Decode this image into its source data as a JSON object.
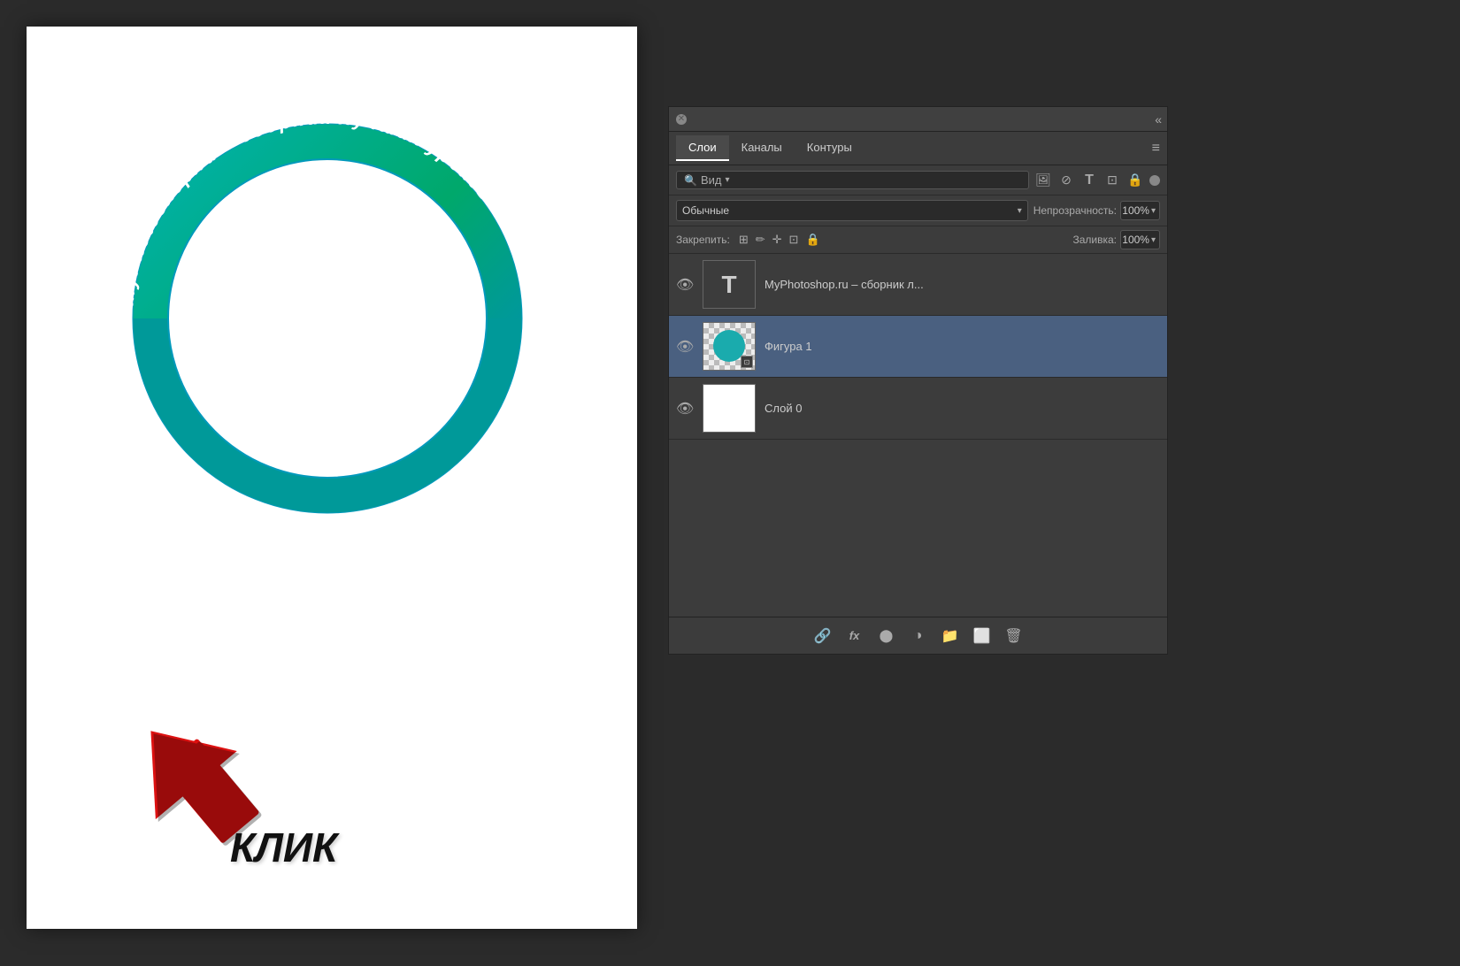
{
  "background_color": "#2b2b2b",
  "canvas": {
    "background": "white"
  },
  "circle_text": "MyPhotoshop.ru – сборник лучших уроков",
  "arrow_label": "КЛИК",
  "panel": {
    "title": "",
    "close_icon": "✕",
    "collapse_icon": "«",
    "tabs": [
      {
        "label": "Слои",
        "active": true
      },
      {
        "label": "Каналы",
        "active": false
      },
      {
        "label": "Контуры",
        "active": false
      }
    ],
    "menu_icon": "≡",
    "search_placeholder": "Вид",
    "filter_icons": [
      "image",
      "circle",
      "T",
      "rect",
      "lock"
    ],
    "blend_mode": "Обычные",
    "blend_dropdown": "▾",
    "opacity_label": "Непрозрачность:",
    "opacity_value": "100%",
    "lock_label": "Закрепить:",
    "lock_icons": [
      "⊞",
      "✏",
      "✛",
      "⊡",
      "🔒"
    ],
    "fill_label": "Заливка:",
    "fill_value": "100%",
    "layers": [
      {
        "id": "layer-text",
        "visible": true,
        "type": "text",
        "thumb_type": "T",
        "name": "MyPhotoshop.ru – сборник л...",
        "selected": false
      },
      {
        "id": "layer-shape",
        "visible": true,
        "type": "shape",
        "thumb_type": "shape",
        "name": "Фигура 1",
        "selected": true
      },
      {
        "id": "layer-0",
        "visible": true,
        "type": "raster",
        "thumb_type": "white",
        "name": "Слой 0",
        "selected": false
      }
    ],
    "bottom_bar_icons": [
      "link",
      "fx",
      "camera",
      "circle-half",
      "folder",
      "copy",
      "trash"
    ]
  }
}
